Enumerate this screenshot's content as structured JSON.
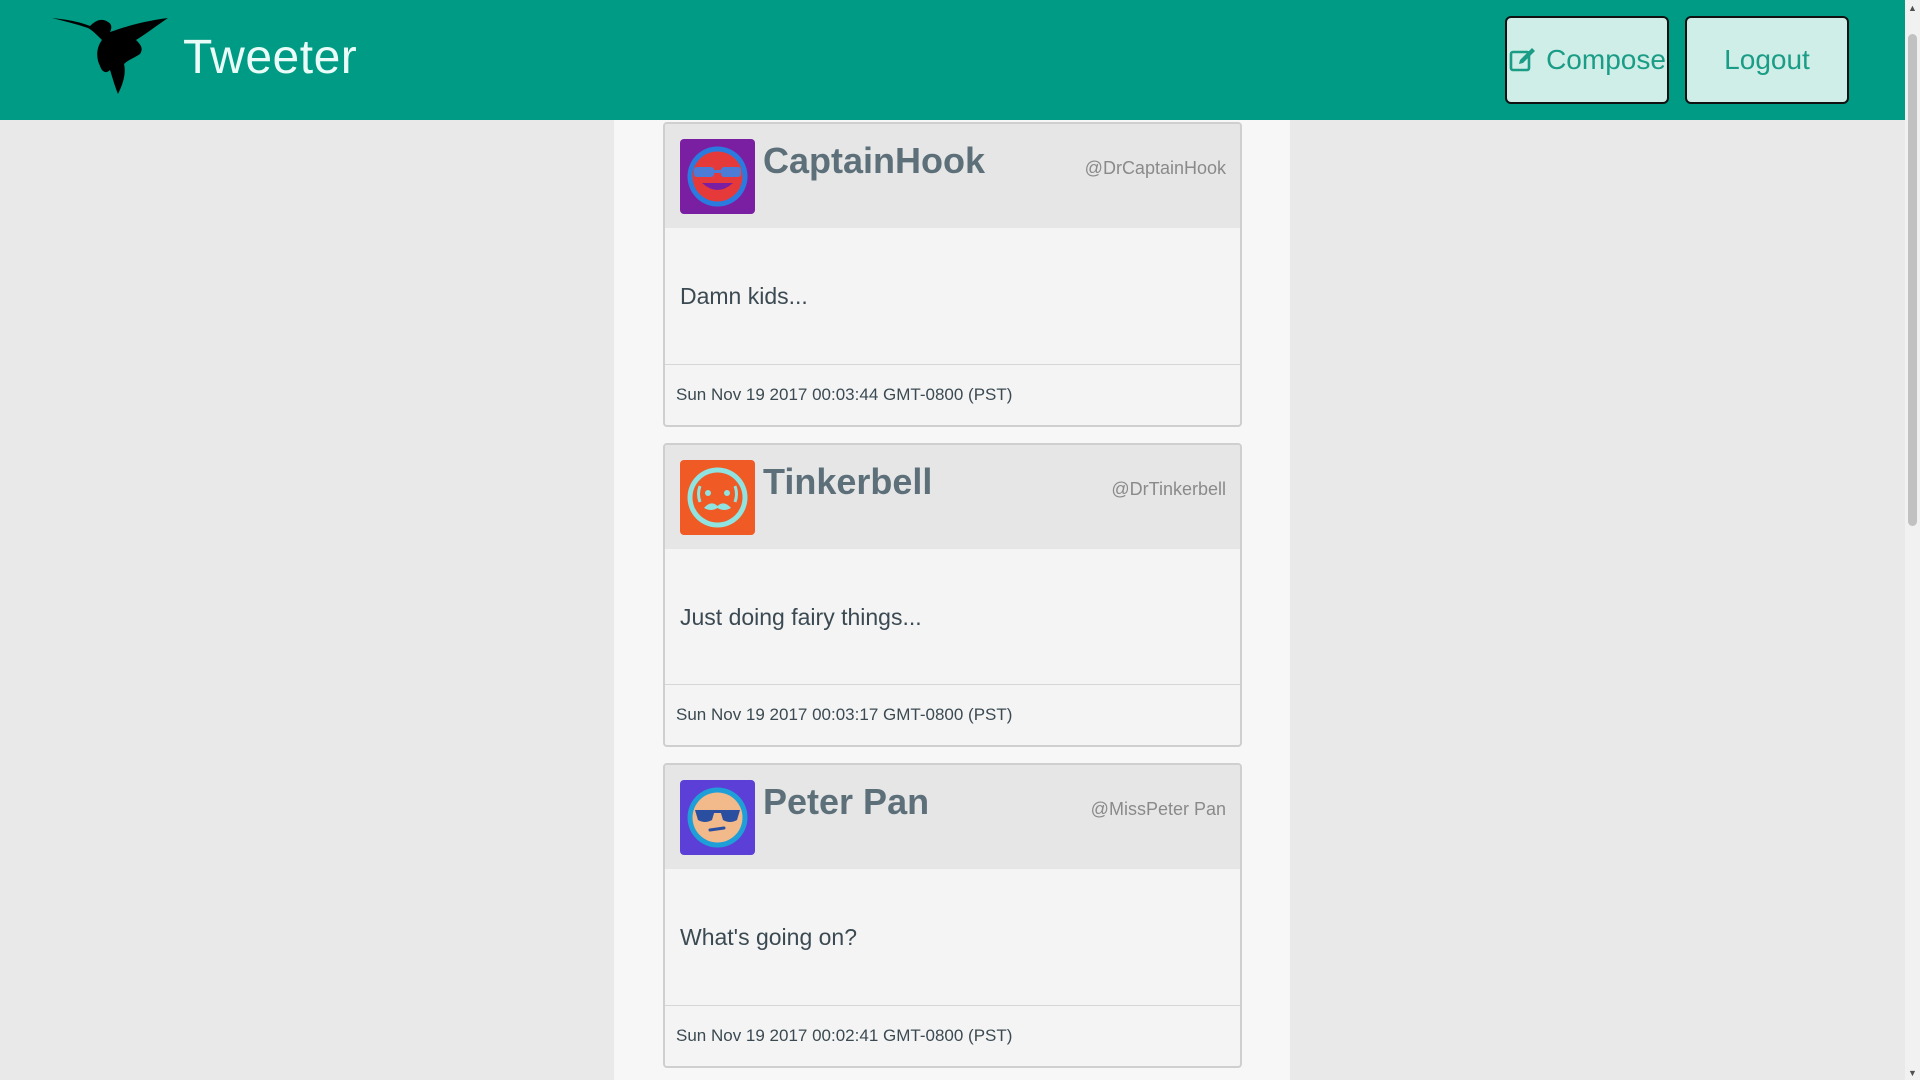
{
  "header": {
    "brand": "Tweeter",
    "logo_icon": "hummingbird-icon",
    "compose_label": "Compose",
    "compose_icon": "pencil-square-icon",
    "logout_label": "Logout",
    "colors": {
      "bar": "#009b84",
      "button_bg": "#cfeee7",
      "button_text": "#1a9c86"
    }
  },
  "tweets": [
    {
      "name": "CaptainHook",
      "handle": "@DrCaptainHook",
      "text": "Damn kids...",
      "timestamp": "Sun Nov 19 2017 00:03:44 GMT-0800 (PST)",
      "avatar_icon": "robot-face-avatar-icon",
      "avatar_color": "#7b1fa2"
    },
    {
      "name": "Tinkerbell",
      "handle": "@DrTinkerbell",
      "text": "Just doing fairy things...",
      "timestamp": "Sun Nov 19 2017 00:03:17 GMT-0800 (PST)",
      "avatar_icon": "mustache-face-avatar-icon",
      "avatar_color": "#f05a24"
    },
    {
      "name": "Peter Pan",
      "handle": "@MissPeter Pan",
      "text": "What's going on?",
      "timestamp": "Sun Nov 19 2017 00:02:41 GMT-0800 (PST)",
      "avatar_icon": "sunglasses-face-avatar-icon",
      "avatar_color": "#5b3fd6"
    }
  ]
}
